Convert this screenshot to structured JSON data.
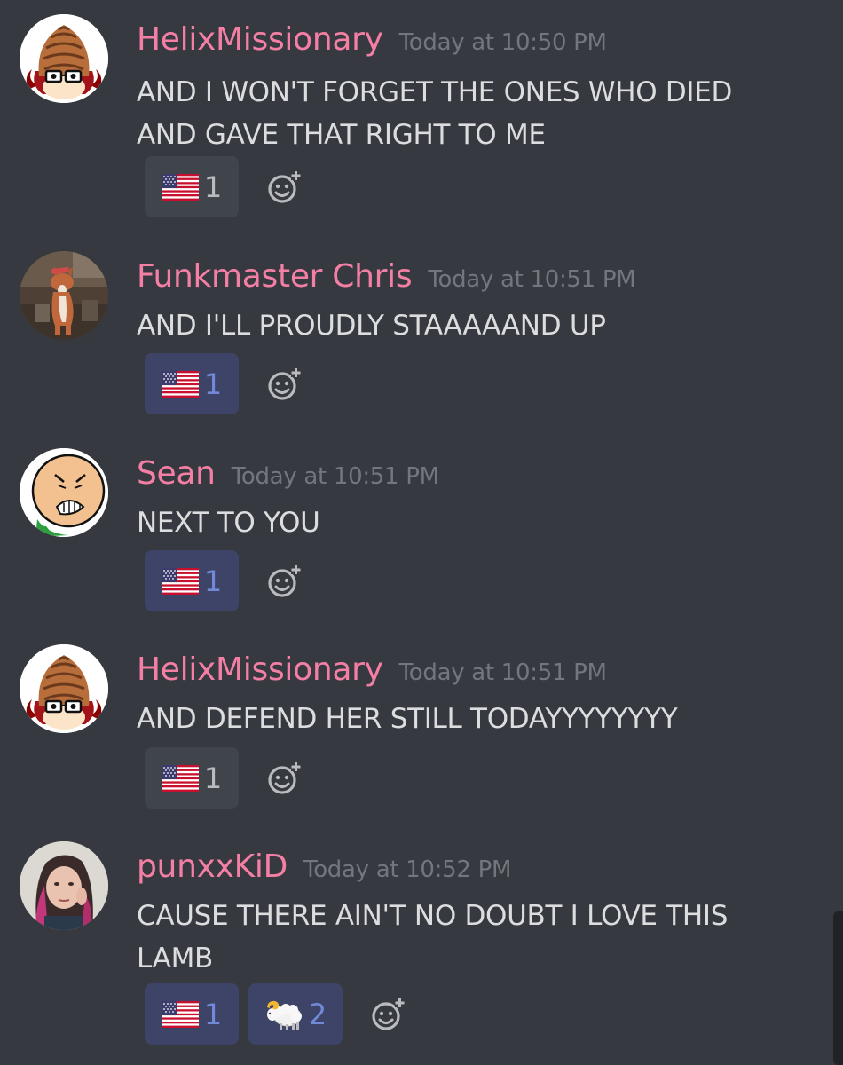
{
  "messages": [
    {
      "username": "HelixMissionary",
      "timestamp": "Today at 10:50 PM",
      "lines": [
        "AND I WON'T FORGET THE ONES WHO DIED",
        "AND GAVE THAT RIGHT TO ME"
      ],
      "avatar": "helix-shell-avatar",
      "reactions": [
        {
          "emoji": "flag-us-icon",
          "count": "1",
          "me": false
        }
      ]
    },
    {
      "username": "Funkmaster Chris",
      "timestamp": "Today at 10:51 PM",
      "lines": [
        "AND I'LL PROUDLY STAAAAAND UP"
      ],
      "avatar": "dog-photo-avatar",
      "reactions": [
        {
          "emoji": "flag-us-icon",
          "count": "1",
          "me": true
        }
      ]
    },
    {
      "username": "Sean",
      "timestamp": "Today at 10:51 PM",
      "lines": [
        "NEXT TO YOU"
      ],
      "avatar": "angry-face-avatar",
      "reactions": [
        {
          "emoji": "flag-us-icon",
          "count": "1",
          "me": true
        }
      ]
    },
    {
      "username": "HelixMissionary",
      "timestamp": "Today at 10:51 PM",
      "lines": [
        "AND DEFEND HER STILL TODAYYYYYYYY"
      ],
      "avatar": "helix-shell-avatar",
      "reactions": [
        {
          "emoji": "flag-us-icon",
          "count": "1",
          "me": false
        }
      ]
    },
    {
      "username": "punxxKiD",
      "timestamp": "Today at 10:52 PM",
      "lines": [
        "CAUSE THERE AIN'T NO DOUBT I LOVE THIS",
        "LAMB"
      ],
      "avatar": "person-photo-avatar",
      "reactions": [
        {
          "emoji": "flag-us-icon",
          "count": "1",
          "me": true
        },
        {
          "emoji": "ram-icon",
          "count": "2",
          "me": true
        }
      ]
    }
  ],
  "colors": {
    "background": "#36393f",
    "username": "#f47fa4",
    "timestamp": "#72767d",
    "text": "#dcddde",
    "reaction_bg": "#40444b",
    "reaction_me_bg": "#3d4467",
    "reaction_me_count": "#7289da"
  },
  "add_reaction_icon": "add-reaction-icon"
}
